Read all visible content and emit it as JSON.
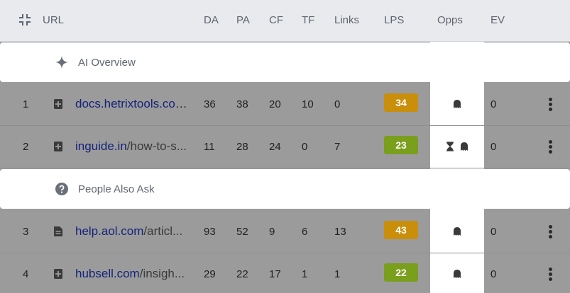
{
  "header": {
    "collapse_icon": "collapse-icon",
    "columns": {
      "url": "URL",
      "da": "DA",
      "pa": "PA",
      "cf": "CF",
      "tf": "TF",
      "links": "Links",
      "lps": "LPS",
      "opps": "Opps",
      "ev": "EV"
    }
  },
  "features": {
    "ai_overview": {
      "label": "AI Overview",
      "icon": "sparkle-icon"
    },
    "people_also_ask": {
      "label": "People Also Ask",
      "icon": "question-icon"
    }
  },
  "rows": [
    {
      "rank": "1",
      "icon": "doc-plus-icon",
      "domain": "docs.hetrixtools.co",
      "path": "m/...",
      "da": "36",
      "pa": "38",
      "cf": "20",
      "tf": "10",
      "links": "0",
      "lps": "34",
      "lps_color": "#c98f0b",
      "opps": [
        "ghost-icon"
      ],
      "ev": "0"
    },
    {
      "rank": "2",
      "icon": "doc-plus-icon",
      "domain": "inguide.in",
      "path": "/how-to-s...",
      "da": "11",
      "pa": "28",
      "cf": "24",
      "tf": "0",
      "links": "7",
      "lps": "23",
      "lps_color": "#7a9f1c",
      "opps": [
        "hourglass-icon",
        "ghost-icon"
      ],
      "ev": "0"
    },
    {
      "rank": "3",
      "icon": "doc-text-icon",
      "domain": "help.aol.com",
      "path": "/articl...",
      "da": "93",
      "pa": "52",
      "cf": "9",
      "tf": "6",
      "links": "13",
      "lps": "43",
      "lps_color": "#c98f0b",
      "opps": [
        "ghost-icon"
      ],
      "ev": "0"
    },
    {
      "rank": "4",
      "icon": "doc-plus-icon",
      "domain": "hubsell.com",
      "path": "/insigh...",
      "da": "29",
      "pa": "22",
      "cf": "17",
      "tf": "1",
      "links": "1",
      "lps": "22",
      "lps_color": "#7a9f1c",
      "opps": [
        "ghost-icon"
      ],
      "ev": "0"
    }
  ]
}
